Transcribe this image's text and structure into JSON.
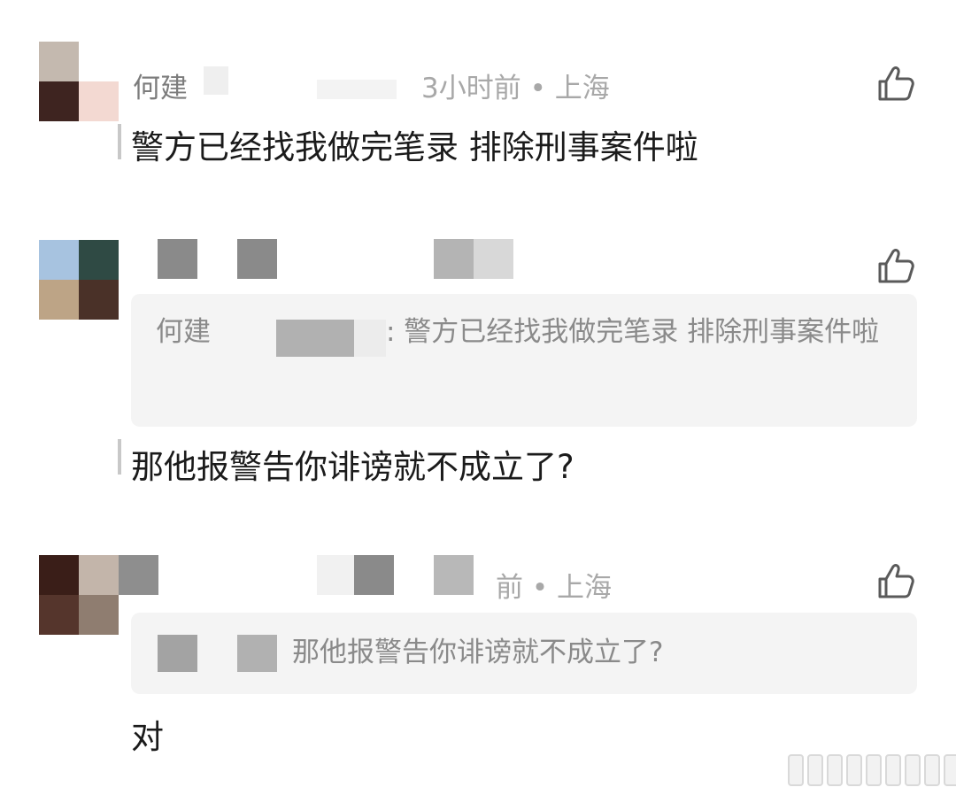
{
  "comments": [
    {
      "author": "何建",
      "time_location": "3小时前 • 上海",
      "text": "警方已经找我做完笔录 排除刑事案件啦"
    },
    {
      "author": "",
      "time_location": "",
      "quote_author": "何建",
      "quote_text": ": 警方已经找我做完笔录 排除刑事案件啦",
      "text": "那他报警告你诽谤就不成立了?"
    },
    {
      "author": "",
      "time_location": "前 • 上海",
      "quote_text": "那他报警告你诽谤就不成立了?",
      "text": "对"
    }
  ],
  "colors": {
    "quote_bg": "#f4f4f4",
    "meta_text": "#a8a8a8",
    "body_text": "#1b1b1b",
    "icon_stroke": "#5a5a5a"
  },
  "icons": {
    "like": "thumbs-up-icon"
  }
}
